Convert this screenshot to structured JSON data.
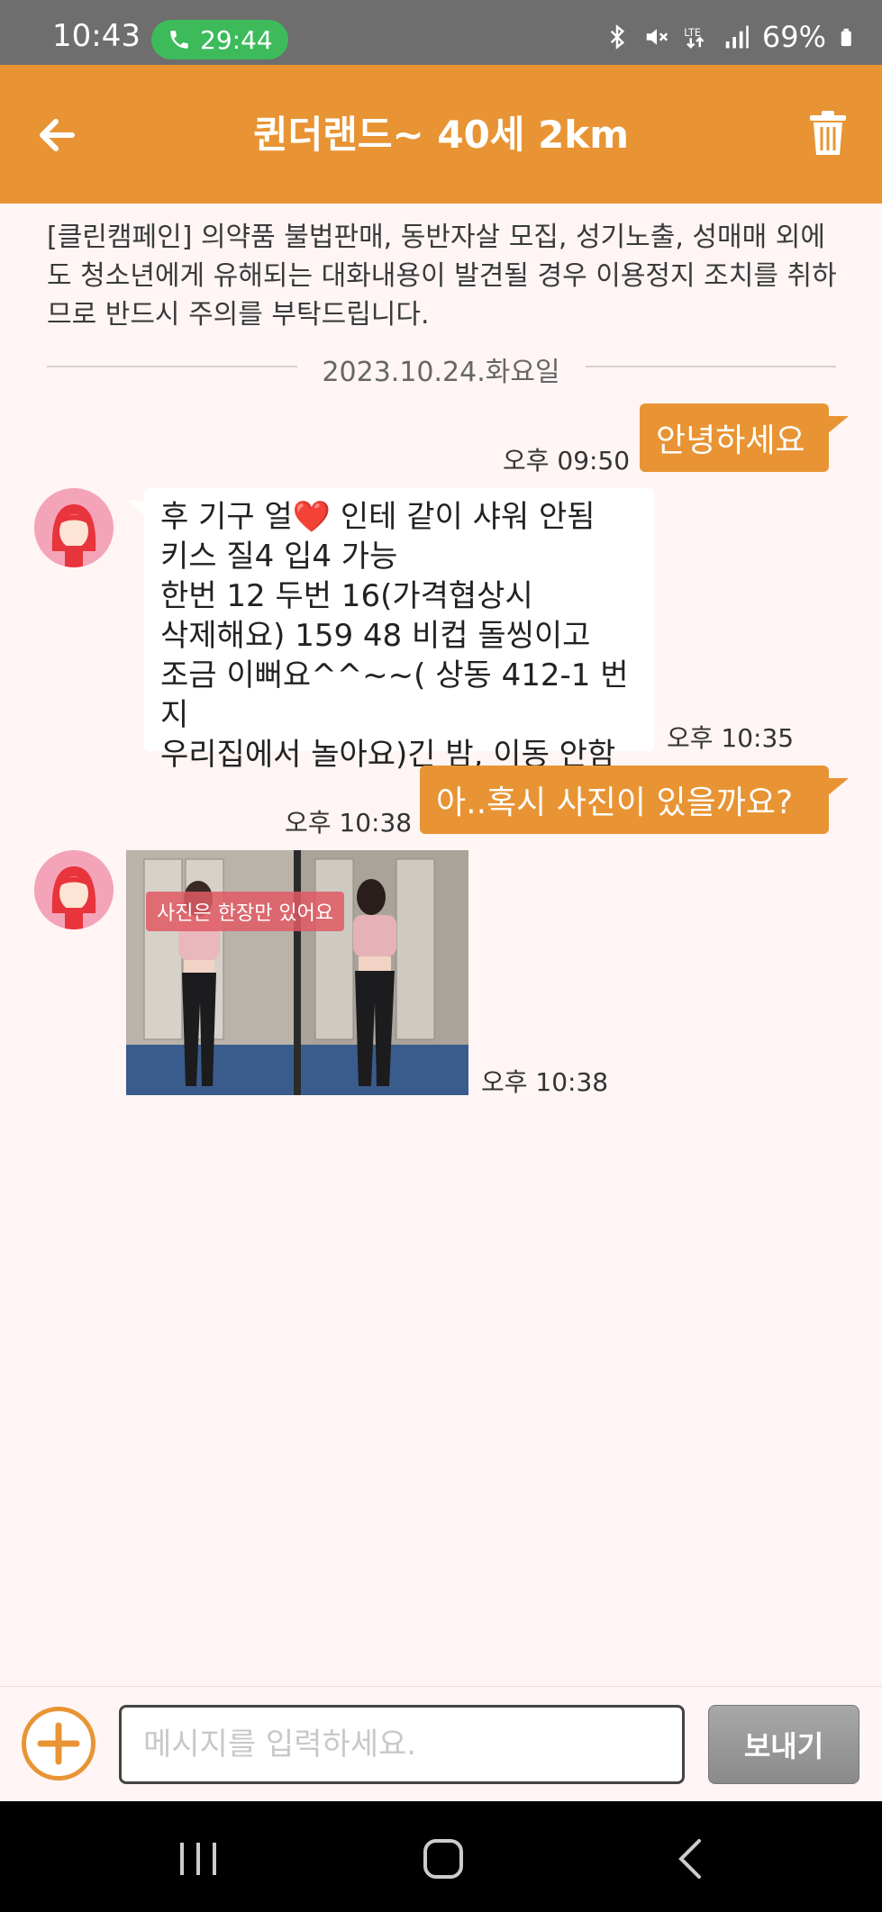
{
  "status_bar": {
    "time": "10:43",
    "call_timer": "29:44",
    "battery": "69%",
    "icons": [
      "bluetooth-icon",
      "mute-icon",
      "lte-icon",
      "signal-icon",
      "battery-icon"
    ]
  },
  "header": {
    "title": "퀸더랜드~ 40세 2km",
    "back_icon": "back-arrow-icon",
    "delete_icon": "trash-icon"
  },
  "notice": {
    "text": "[클린캠페인] 의약품 불법판매, 동반자살 모집, 성기노출, 성매매 외에도 청소년에게 유해되는 대화내용이 발견될 경우 이용정지 조치를 취하므로 반드시 주의를 부탁드립니다."
  },
  "date_divider": "2023.10.24.화요일",
  "messages": [
    {
      "direction": "out",
      "text": "안녕하세요",
      "time": "오후 09:50"
    },
    {
      "direction": "in",
      "lines": [
        "후 기구 얼❤️ 인테 같이 샤워 안됨",
        "키스 질4 입4  가능",
        "한번 12 두번 16(가격협상시",
        "삭제해요) 159  48 비컵 돌씽이고",
        "조금 이뻐요^^~~( 상동 412-1 번지",
        "우리집에서 놀아요)긴 밤, 이동 안함"
      ],
      "time": "오후 10:35"
    },
    {
      "direction": "out",
      "text": "아..혹시 사진이 있을까요?",
      "time": "오후 10:38"
    },
    {
      "direction": "in",
      "type": "image",
      "caption": "사진은 한장만 있어요",
      "time": "오후 10:38"
    }
  ],
  "input_bar": {
    "placeholder": "메시지를 입력하세요.",
    "value": "",
    "send_label": "보내기",
    "attach_icon": "plus-circle-icon"
  },
  "colors": {
    "accent": "#e89434",
    "background": "#fff5f5",
    "status_bar": "#6e6e6e",
    "call_pill": "#3dbb5b"
  }
}
